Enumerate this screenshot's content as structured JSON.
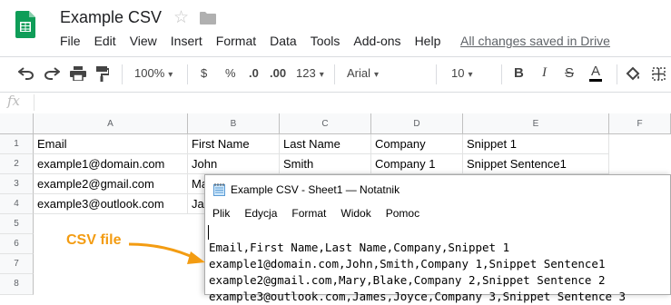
{
  "header": {
    "title": "Example CSV",
    "saved_status": "All changes saved in Drive",
    "menu": [
      "File",
      "Edit",
      "View",
      "Insert",
      "Format",
      "Data",
      "Tools",
      "Add-ons",
      "Help"
    ]
  },
  "toolbar": {
    "zoom": "100%",
    "currency": "$",
    "percent": "%",
    "decimal_decrease": ".0",
    "decimal_increase": ".00",
    "more_formats": "123",
    "font": "Arial",
    "font_size": "10",
    "bold": "B",
    "italic": "I",
    "strikethrough": "S",
    "text_color": "A",
    "text_color_value": "#000000"
  },
  "formula_bar": {
    "fx": "fx"
  },
  "sheet": {
    "columns": [
      "A",
      "B",
      "C",
      "D",
      "E",
      "F"
    ],
    "rows": [
      "1",
      "2",
      "3",
      "4",
      "5",
      "6",
      "7",
      "8"
    ],
    "cells": [
      [
        "Email",
        "First Name",
        "Last Name",
        "Company",
        "Snippet 1"
      ],
      [
        "example1@domain.com",
        "John",
        "Smith",
        "Company 1",
        "Snippet Sentence1"
      ],
      [
        "example2@gmail.com",
        "Ma",
        "",
        "",
        ""
      ],
      [
        "example3@outlook.com",
        "Ja",
        "",
        "",
        ""
      ]
    ]
  },
  "notepad": {
    "title": "Example CSV - Sheet1 — Notatnik",
    "menu": [
      "Plik",
      "Edycja",
      "Format",
      "Widok",
      "Pomoc"
    ],
    "lines": [
      "Email,First Name,Last Name,Company,Snippet 1",
      "example1@domain.com,John,Smith,Company 1,Snippet Sentence1",
      "example2@gmail.com,Mary,Blake,Company 2,Snippet Sentence 2",
      "example3@outlook.com,James,Joyce,Company 3,Snippet Sentence 3"
    ]
  },
  "annotation": {
    "label": "CSV file",
    "color": "#f39c12"
  },
  "colors": {
    "sheets_green": "#0f9d58",
    "header_bg": "#f8f9fa",
    "grid_line": "#e2e3e3"
  }
}
